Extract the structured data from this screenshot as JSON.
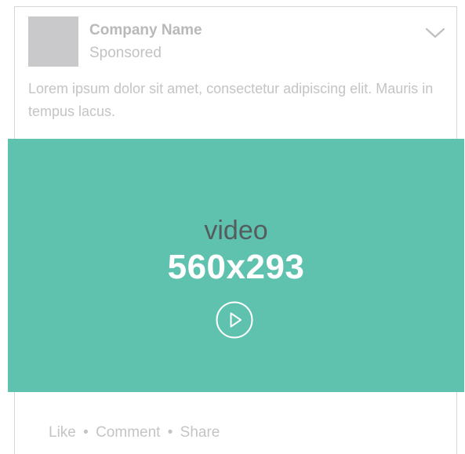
{
  "post": {
    "company_name": "Company Name",
    "sponsored_label": "Sponsored",
    "description": "Lorem ipsum dolor sit amet, consectetur adipiscing elit. Mauris in tempus lacus.",
    "video": {
      "label": "video",
      "size": "560x293",
      "play_icon": "play-icon"
    },
    "actions": {
      "like": "Like",
      "comment": "Comment",
      "share": "Share",
      "separator": "•"
    },
    "menu_icon": "chevron-down-icon"
  },
  "colors": {
    "video_bg": "#5fc2ae",
    "avatar_placeholder": "#c9c9cb",
    "muted_text": "#c4c4c4"
  }
}
